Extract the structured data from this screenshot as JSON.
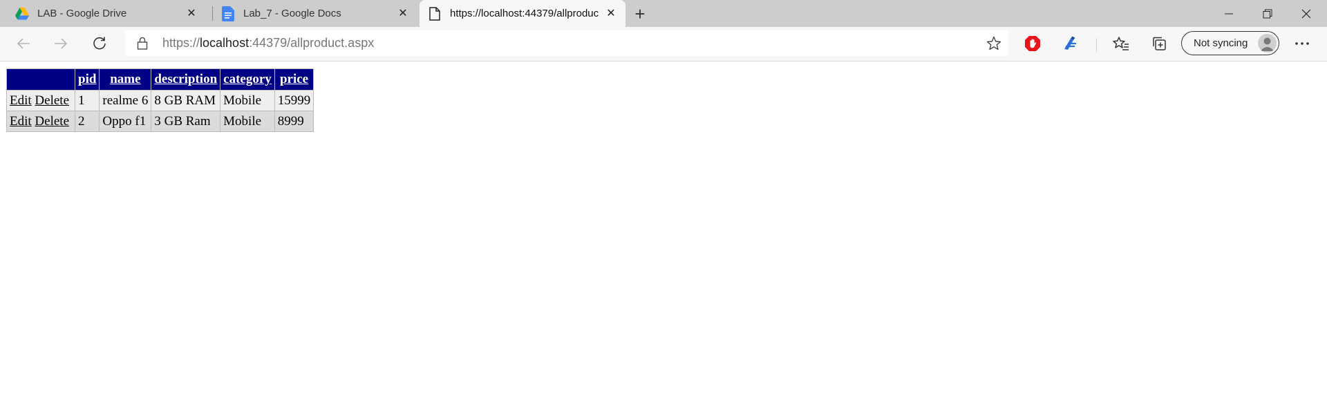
{
  "tabs": [
    {
      "title": "LAB - Google Drive",
      "icon": "google-drive-icon"
    },
    {
      "title": "Lab_7 - Google Docs",
      "icon": "google-docs-icon"
    },
    {
      "title": "https://localhost:44379/allproduct.aspx",
      "icon": "page-icon"
    }
  ],
  "toolbar": {
    "url_scheme": "https://",
    "url_host": "localhost",
    "url_rest": ":44379/allproduct.aspx",
    "profile_label": "Not syncing"
  },
  "grid": {
    "headers": [
      "",
      "pid",
      "name",
      "description",
      "category",
      "price"
    ],
    "edit_label": "Edit",
    "delete_label": "Delete",
    "rows": [
      {
        "pid": "1",
        "name": "realme 6",
        "description": "8 GB RAM",
        "category": "Mobile",
        "price": "15999"
      },
      {
        "pid": "2",
        "name": "Oppo f1",
        "description": "3 GB Ram",
        "category": "Mobile",
        "price": "8999"
      }
    ]
  },
  "colors": {
    "header_bg": "#000084",
    "row_odd": "#eeeeee",
    "row_even": "#dcdcdc",
    "tabstrip": "#cdcdcd"
  }
}
